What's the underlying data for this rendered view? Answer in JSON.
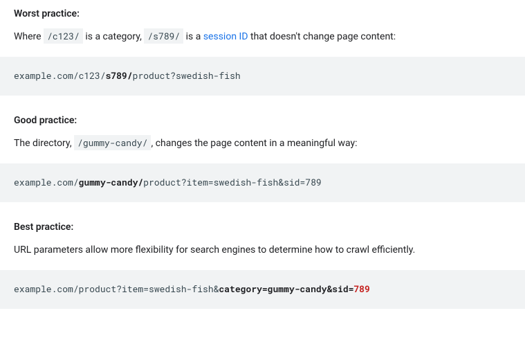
{
  "sections": [
    {
      "title": "Worst practice:",
      "desc_parts": {
        "pre": "Where ",
        "code1": "/c123/",
        "mid1": " is a category, ",
        "code2": "/s789/",
        "mid2": " is a ",
        "link_text": "session ID",
        "post": " that doesn't change page content:"
      },
      "code": {
        "p1": "example.com/c123/",
        "b1": "s789/",
        "p2": "product?swedish-fish"
      }
    },
    {
      "title": "Good practice:",
      "desc_parts": {
        "pre": "The directory, ",
        "code1": "/gummy-candy/",
        "post": ", changes the page content in a meaningful way:"
      },
      "code": {
        "p1": "example.com/",
        "b1": "gummy-candy/",
        "p2": "product?item=swedish-fish&sid=789"
      }
    },
    {
      "title": "Best practice:",
      "desc_plain": "URL parameters allow more flexibility for search engines to determine how to crawl efficiently.",
      "code": {
        "p1": "example.com/product?item=swedish-fish&",
        "b1": "category=gummy-candy&sid=",
        "r1": "789"
      }
    }
  ]
}
